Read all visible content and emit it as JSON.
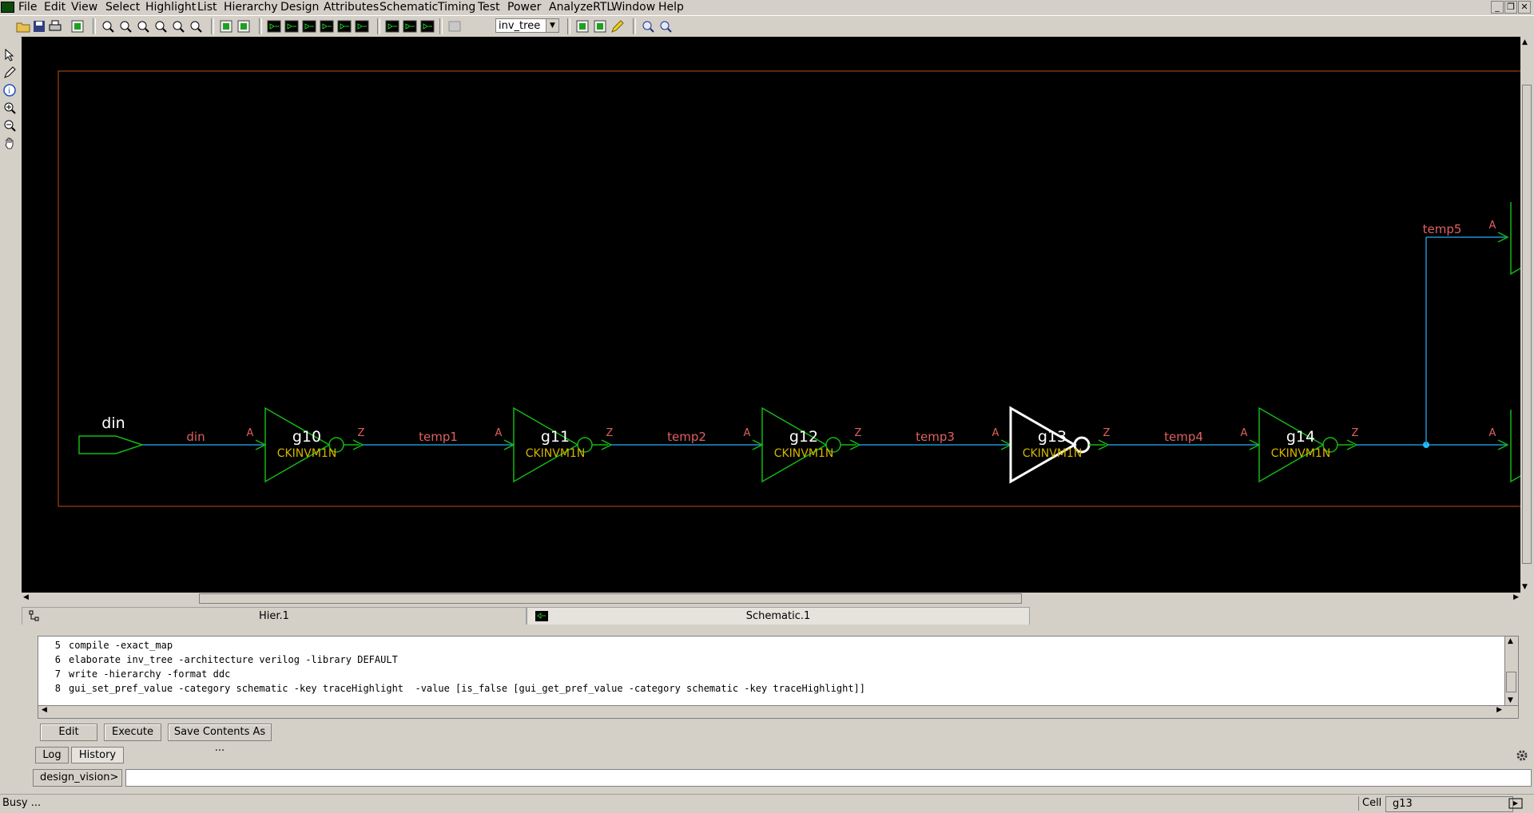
{
  "menu": [
    "File",
    "Edit",
    "View",
    "Select",
    "Highlight",
    "List",
    "Hierarchy",
    "Design",
    "Attributes",
    "Schematic",
    "Timing",
    "Test",
    "Power",
    "AnalyzeRTL",
    "Window",
    "Help"
  ],
  "toolbar": {
    "design_select": "inv_tree"
  },
  "schematic": {
    "input_port": "din",
    "nets": [
      "din",
      "temp1",
      "temp2",
      "temp3",
      "temp4",
      "temp5"
    ],
    "cells": [
      {
        "name": "g10",
        "lib": "CKINVM1N"
      },
      {
        "name": "g11",
        "lib": "CKINVM1N"
      },
      {
        "name": "g12",
        "lib": "CKINVM1N"
      },
      {
        "name": "g13",
        "lib": "CKINVM1N",
        "selected": true
      },
      {
        "name": "g14",
        "lib": "CKINVM1N"
      }
    ],
    "pin_in": "A",
    "pin_out": "Z",
    "colors": {
      "net": "#1f8fcf",
      "cell": "#14b814",
      "label": "#e06060",
      "lib": "#d6b400",
      "selected": "#ffffff",
      "boundary": "#c0501a"
    }
  },
  "tabs": [
    {
      "label": "Hier.1",
      "icon": "hierarchy-icon"
    },
    {
      "label": "Schematic.1",
      "icon": "schematic-icon"
    }
  ],
  "console": {
    "lines": [
      {
        "num": "5",
        "text": "compile -exact_map"
      },
      {
        "num": "6",
        "text": "elaborate inv_tree -architecture verilog -library DEFAULT"
      },
      {
        "num": "7",
        "text": "write -hierarchy -format ddc"
      },
      {
        "num": "8",
        "text": "gui_set_pref_value -category schematic -key traceHighlight  -value [is_false [gui_get_pref_value -category schematic -key traceHighlight]]"
      }
    ]
  },
  "buttons": {
    "edit": "Edit",
    "execute": "Execute",
    "save": "Save Contents As ..."
  },
  "subtabs": {
    "log": "Log",
    "history": "History"
  },
  "prompt": {
    "label": "design_vision>",
    "value": ""
  },
  "status": {
    "text": "Busy ...",
    "cell_label": "Cell",
    "cell_value": "g13"
  }
}
